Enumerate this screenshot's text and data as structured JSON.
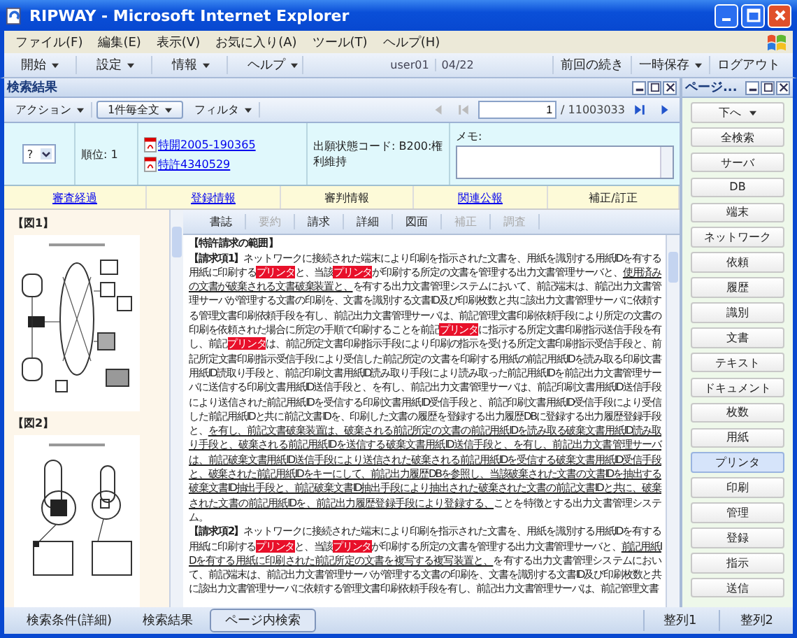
{
  "window": {
    "title": "RIPWAY - Microsoft Internet Explorer"
  },
  "menu": [
    "ファイル(F)",
    "編集(E)",
    "表示(V)",
    "お気に入り(A)",
    "ツール(T)",
    "ヘルプ(H)"
  ],
  "toolbar": {
    "menus": [
      "開始",
      "設定",
      "情報",
      "ヘルプ"
    ],
    "user": "user01",
    "date": "04/22",
    "actions": [
      {
        "label": "前回の続き",
        "dropdown": false
      },
      {
        "label": "一時保存",
        "dropdown": true
      },
      {
        "label": "ログアウト",
        "dropdown": false
      }
    ]
  },
  "results_panel": {
    "title": "検索結果",
    "toolbar": {
      "action": "アクション",
      "view": "1件毎全文",
      "filter": "フィルタ",
      "page": "1",
      "total": "/ 11003033"
    },
    "result": {
      "rating": "?",
      "rank": "順位: 1",
      "documents": [
        "特開2005-190365",
        "特許4340529"
      ],
      "status": "出願状態コード: B200:権利維持",
      "memo_label": "メモ:"
    },
    "links": [
      {
        "label": "審査経過",
        "link": true
      },
      {
        "label": "登録情報",
        "link": true
      },
      {
        "label": "審判情報",
        "link": false
      },
      {
        "label": "関連公報",
        "link": true
      },
      {
        "label": "補正/訂正",
        "link": false
      }
    ],
    "figures": [
      "【図1】",
      "【図2】"
    ],
    "tabs": [
      {
        "label": "書誌",
        "disabled": false
      },
      {
        "label": "要約",
        "disabled": true
      },
      {
        "label": "請求",
        "disabled": false
      },
      {
        "label": "詳細",
        "disabled": false
      },
      {
        "label": "図面",
        "disabled": false
      },
      {
        "label": "補正",
        "disabled": true
      },
      {
        "label": "調査",
        "disabled": true
      }
    ],
    "heading": "【特許請求の範囲】",
    "claims": [
      {
        "label": "【請求項1】",
        "segments": [
          {
            "kind": "text",
            "text": "ネットワークに接続された端末により印刷を指示された文書を、用紙を識別する用紙IDを有する用紙に印刷する"
          },
          {
            "kind": "hit",
            "text": "プリンタ"
          },
          {
            "kind": "text",
            "text": "と、当該"
          },
          {
            "kind": "hit",
            "text": "プリンタ"
          },
          {
            "kind": "text",
            "text": "が印刷する所定の文書を管理する出力文書管理サーバと、"
          },
          {
            "kind": "underline",
            "text": "使用済みの文書が破棄される文書破棄装置と、"
          },
          {
            "kind": "text",
            "text": "を有する出力文書管理システムにおいて、前記端末は、前記出力文書管理サーバが管理する文書の印刷を、文書を識別する文書ID及び印刷枚数と共に該出力文書管理サーバに依頼する管理文書印刷依頼手段を有し、前記出力文書管理サーバは、前記管理文書印刷依頼手段により所定の文書の印刷を依頼された場合に所定の手順で印刷することを前記"
          },
          {
            "kind": "hit",
            "text": "プリンタ"
          },
          {
            "kind": "text",
            "text": "に指示する所定文書印刷指示送信手段を有し、前記"
          },
          {
            "kind": "hit",
            "text": "プリンタ"
          },
          {
            "kind": "text",
            "text": "は、前記所定文書印刷指示手段により印刷の指示を受ける所定文書印刷指示受信手段と、前記所定文書印刷指示受信手段により受信した前記所定の文書を印刷する用紙の前記用紙IDを読み取る印刷文書用紙ID読取り手段と、前記印刷文書用紙ID読み取り手段により読み取った前記用紙IDを前記出力文書管理サーバに送信する印刷文書用紙ID送信手段と、を有し、前記出力文書管理サーバは、前記印刷文書用紙ID送信手段により送信された前記用紙IDを受信する印刷文書用紙ID受信手段と、前記印刷文書用紙ID受信手段により受信した前記用紙IDと共に前記文書IDを、印刷した文書の履歴を登録する出力履歴DBに登録する出力履歴登録手段と、"
          },
          {
            "kind": "underline",
            "text": "を有し、前記文書破棄装置は、破棄される前記所定の文書の前記用紙IDを読み取る破棄文書用紙ID読み取り手段と、破棄される前記用紙IDを送信する破棄文書用紙ID送信手段と、を有し、前記出力文書管理サーバは、前記破棄文書用紙ID送信手段により送信された破棄される前記用紙IDを受信する破棄文書用紙ID受信手段と、破棄された前記用紙IDをキーにして、前記出力履歴DBを参照し、当該破棄された文書の文書IDを抽出する破棄文書ID抽出手段と、前記破棄文書ID抽出手段により抽出された破棄された文書の前記文書IDと共に、破棄された文書の前記用紙IDを、前記出力履歴登録手段により登録する、"
          },
          {
            "kind": "text",
            "text": "ことを特徴とする出力文書管理システム。"
          }
        ]
      },
      {
        "label": "【請求項2】",
        "segments": [
          {
            "kind": "text",
            "text": "ネットワークに接続された端末により印刷を指示された文書を、用紙を識別する用紙IDを有する用紙に印刷する"
          },
          {
            "kind": "hit",
            "text": "プリンタ"
          },
          {
            "kind": "text",
            "text": "と、当該"
          },
          {
            "kind": "hit",
            "text": "プリンタ"
          },
          {
            "kind": "text",
            "text": "が印刷する所定の文書を管理する出力文書管理サーバと、"
          },
          {
            "kind": "underline",
            "text": "前記用紙IDを有する用紙に印刷された前記所定の文書を複写する複写装置と、"
          },
          {
            "kind": "text",
            "text": "を有する出力文書管理システムにおいて、前記端末は、前記出力文書管理サーバが管理する文書の印刷を、文書を識別する文書ID及び印刷枚数と共に該出力文書管理サーバに依頼する管理文書印刷依頼手段を有し、前記出力文書管理サーバは、前記管理文書"
          }
        ]
      }
    ]
  },
  "side_panel": {
    "title": "ページ...",
    "buttons": [
      {
        "label": "下へ",
        "selected": false,
        "dropdown": true
      },
      {
        "label": "全検索",
        "selected": false,
        "dropdown": false
      },
      {
        "label": "サーバ",
        "selected": false,
        "dropdown": false
      },
      {
        "label": "DB",
        "selected": false,
        "dropdown": false
      },
      {
        "label": "端末",
        "selected": false,
        "dropdown": false
      },
      {
        "label": "ネットワーク",
        "selected": false,
        "dropdown": false
      },
      {
        "label": "依頼",
        "selected": false,
        "dropdown": false
      },
      {
        "label": "履歴",
        "selected": false,
        "dropdown": false
      },
      {
        "label": "識別",
        "selected": false,
        "dropdown": false
      },
      {
        "label": "文書",
        "selected": false,
        "dropdown": false
      },
      {
        "label": "テキスト",
        "selected": false,
        "dropdown": false
      },
      {
        "label": "ドキュメント",
        "selected": false,
        "dropdown": false
      },
      {
        "label": "枚数",
        "selected": false,
        "dropdown": false
      },
      {
        "label": "用紙",
        "selected": false,
        "dropdown": false
      },
      {
        "label": "プリンタ",
        "selected": true,
        "dropdown": false
      },
      {
        "label": "印刷",
        "selected": false,
        "dropdown": false
      },
      {
        "label": "管理",
        "selected": false,
        "dropdown": false
      },
      {
        "label": "登録",
        "selected": false,
        "dropdown": false
      },
      {
        "label": "指示",
        "selected": false,
        "dropdown": false
      },
      {
        "label": "送信",
        "selected": false,
        "dropdown": false
      }
    ]
  },
  "status_bar": {
    "tabs": [
      {
        "label": "検索条件(詳細)",
        "selected": false
      },
      {
        "label": "検索結果",
        "selected": false
      },
      {
        "label": "ページ内検索",
        "selected": true
      }
    ],
    "sort": [
      "整列1",
      "整列2"
    ]
  }
}
